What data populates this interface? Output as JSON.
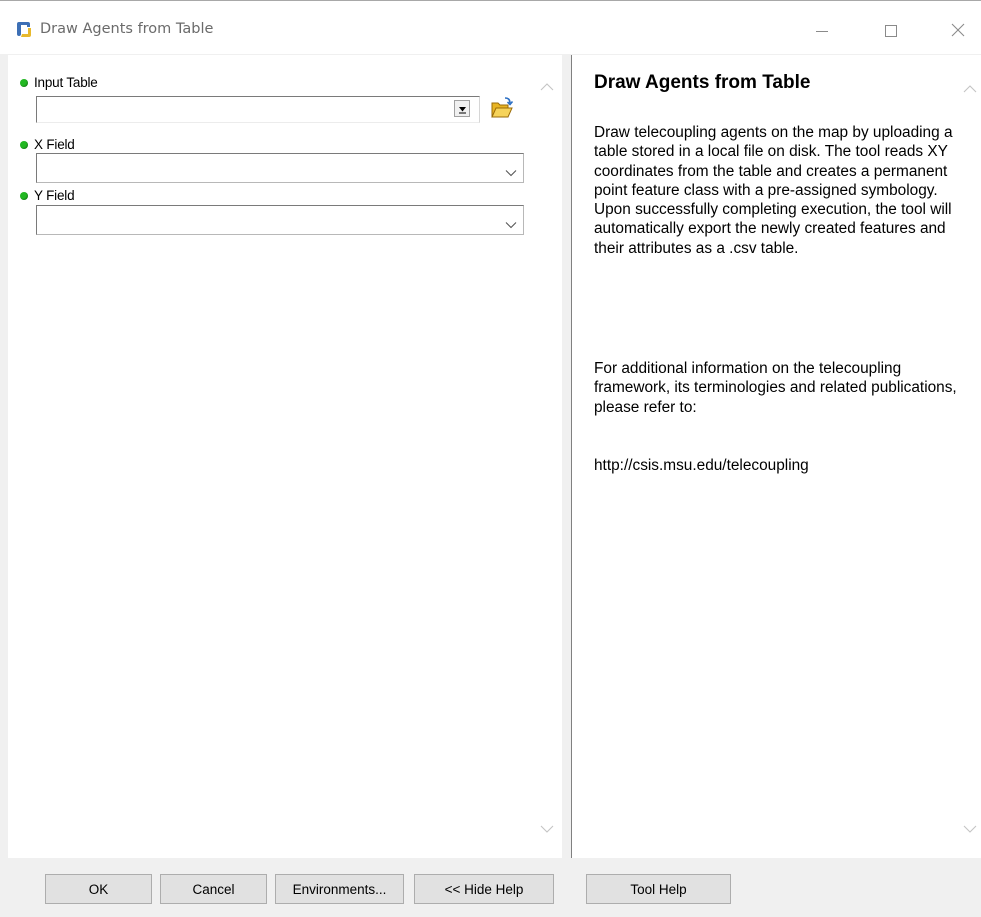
{
  "window": {
    "title": "Draw Agents from Table",
    "icon": "python-script-icon",
    "controls": [
      "minimize-icon",
      "maximize-icon",
      "close-icon"
    ]
  },
  "parameters": [
    {
      "label": "Input Table",
      "value": "",
      "control": "dropdown-with-browse",
      "required": true
    },
    {
      "label": "X Field",
      "value": "",
      "control": "combobox",
      "required": true
    },
    {
      "label": "Y Field",
      "value": "",
      "control": "combobox",
      "required": true
    }
  ],
  "help": {
    "title": "Draw Agents from Table",
    "paragraphs": [
      "Draw telecoupling agents on the map by uploading a table stored in a local file on disk. The tool reads XY coordinates from the table and creates a permanent point feature class with a pre-assigned symbology. Upon successfully completing execution, the tool will automatically export the newly created features and their attributes as a .csv table.",
      "For additional information on the telecoupling framework, its terminologies and related publications, please refer to:",
      "http://csis.msu.edu/telecoupling"
    ]
  },
  "buttons": {
    "ok": "OK",
    "cancel": "Cancel",
    "environments": "Environments...",
    "hide_help": "<< Hide Help",
    "tool_help": "Tool Help"
  },
  "colors": {
    "required_dot": "#22b822",
    "pane_bg": "#ffffff",
    "dialog_bg": "#f0f0f0"
  }
}
